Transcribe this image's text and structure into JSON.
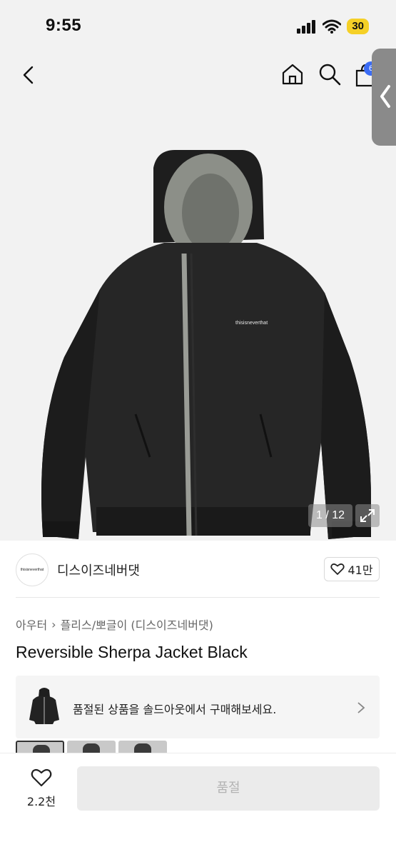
{
  "status_bar": {
    "time": "9:55",
    "battery": "30"
  },
  "nav": {
    "cart_badge": "6"
  },
  "gallery": {
    "pager": "1 / 12",
    "jacket_logo_text": "thisisneverthat"
  },
  "brand": {
    "name": "디스이즈네버댓",
    "logo_text": "thisisneverthat",
    "likes": "41만"
  },
  "breadcrumb": {
    "category": "아우터",
    "separator": "›",
    "subcategory": "플리스/뽀글이 (디스이즈네버댓)"
  },
  "product": {
    "title": "Reversible Sherpa Jacket Black"
  },
  "banner": {
    "text": "품절된 상품을 솔드아웃에서 구매해보세요."
  },
  "bottom": {
    "wish_count": "2.2천",
    "button_label": "품절"
  },
  "colors": {
    "accent": "#3b6cf5",
    "battery": "#f5d027",
    "background": "#f2f2f2"
  }
}
